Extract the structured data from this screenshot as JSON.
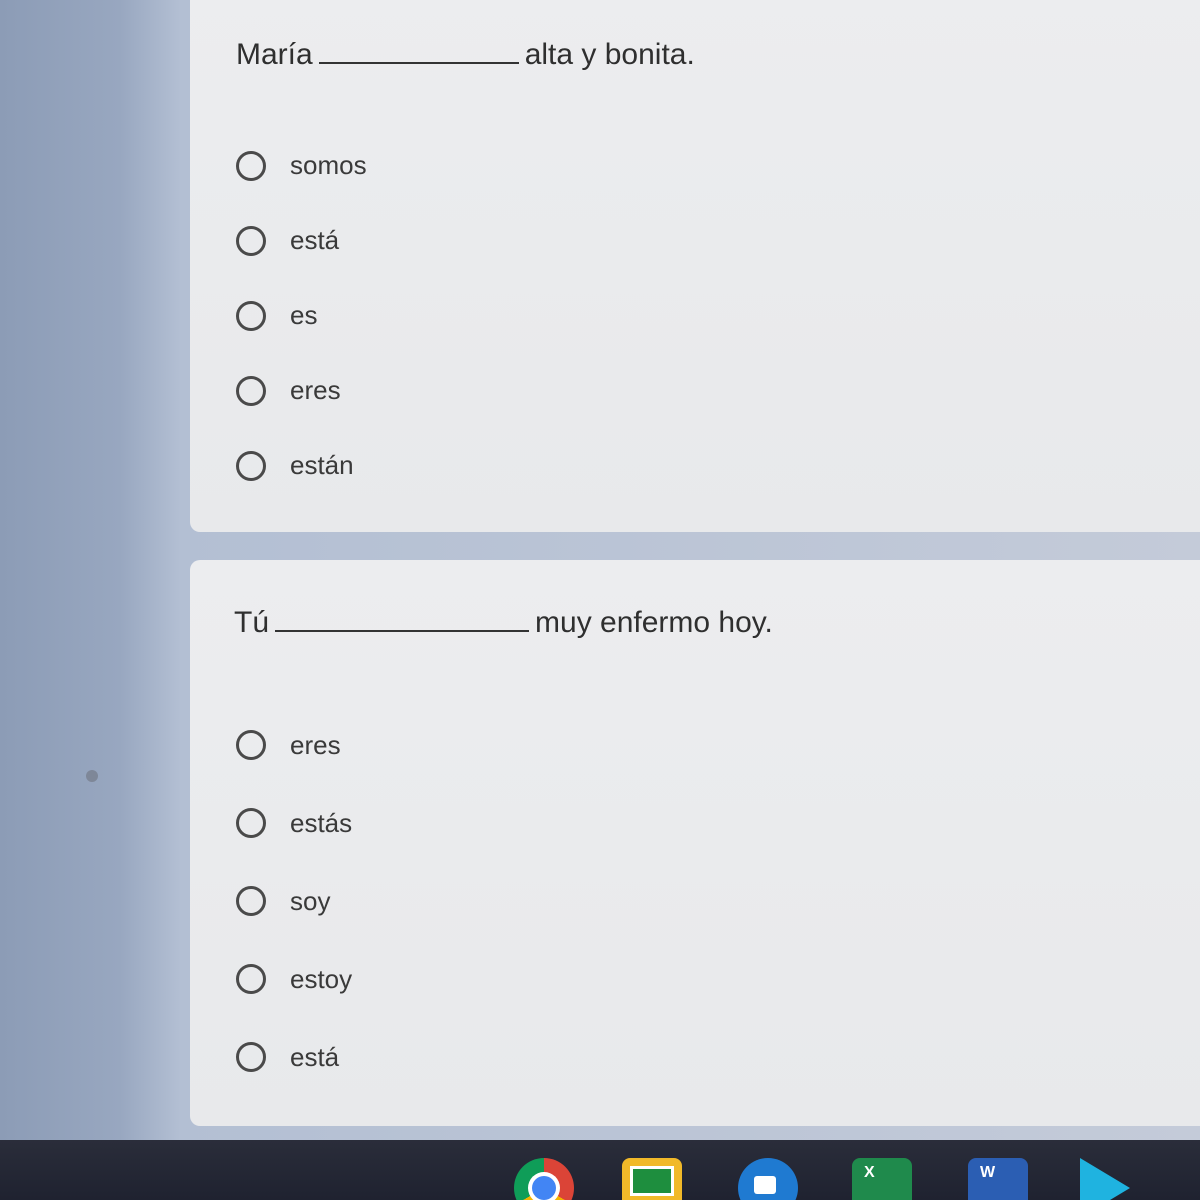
{
  "questions": [
    {
      "subject": "María",
      "predicate": "alta y bonita.",
      "options": [
        "somos",
        "está",
        "es",
        "eres",
        "están"
      ]
    },
    {
      "subject": "Tú",
      "predicate": "muy enfermo hoy.",
      "options": [
        "eres",
        "estás",
        "soy",
        "estoy",
        "está"
      ]
    }
  ],
  "taskbar": {
    "apps": [
      {
        "name": "chrome-icon"
      },
      {
        "name": "classroom-icon"
      },
      {
        "name": "meet-icon"
      },
      {
        "name": "sheets-icon",
        "label": "X"
      },
      {
        "name": "docs-icon",
        "label": "W"
      },
      {
        "name": "play-store-icon"
      }
    ]
  },
  "colors": {
    "card": "#ececed",
    "background": "#a9b5ca",
    "taskbar": "#23263a",
    "radio": "#4a4a4a"
  }
}
